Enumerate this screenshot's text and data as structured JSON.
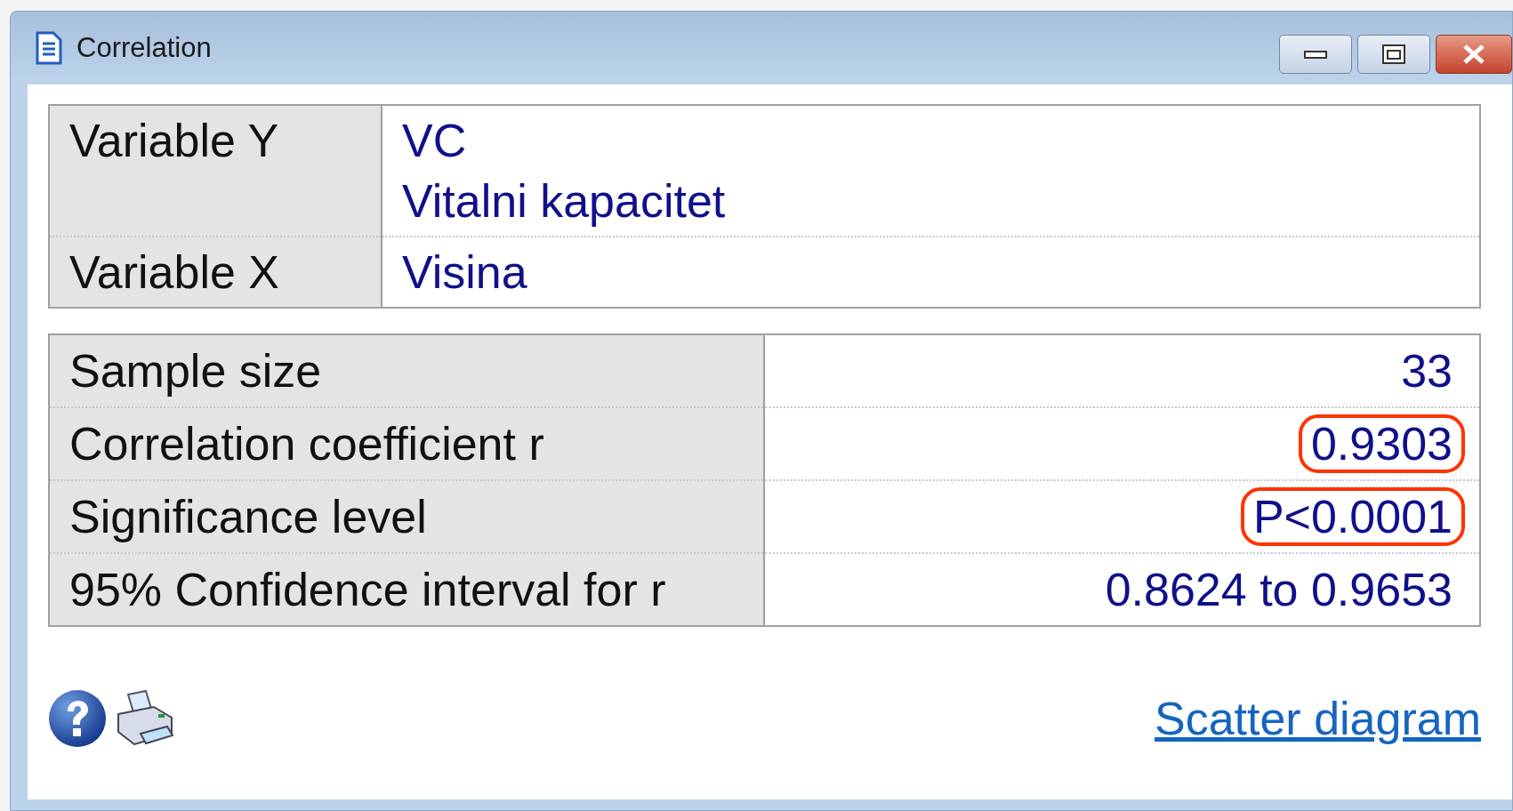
{
  "window": {
    "title": "Correlation"
  },
  "variables": [
    {
      "label": "Variable Y",
      "lines": [
        "VC",
        "Vitalni kapacitet"
      ]
    },
    {
      "label": "Variable X",
      "lines": [
        "Visina"
      ]
    }
  ],
  "results": [
    {
      "label": "Sample size",
      "value": "33",
      "highlighted": false
    },
    {
      "label": "Correlation coefficient r",
      "value": "0.9303",
      "highlighted": true
    },
    {
      "label": "Significance level",
      "value": "P<0.0001",
      "highlighted": true
    },
    {
      "label": "95% Confidence interval for r",
      "value": "0.8624 to 0.9653",
      "highlighted": false
    }
  ],
  "link": "Scatter diagram"
}
